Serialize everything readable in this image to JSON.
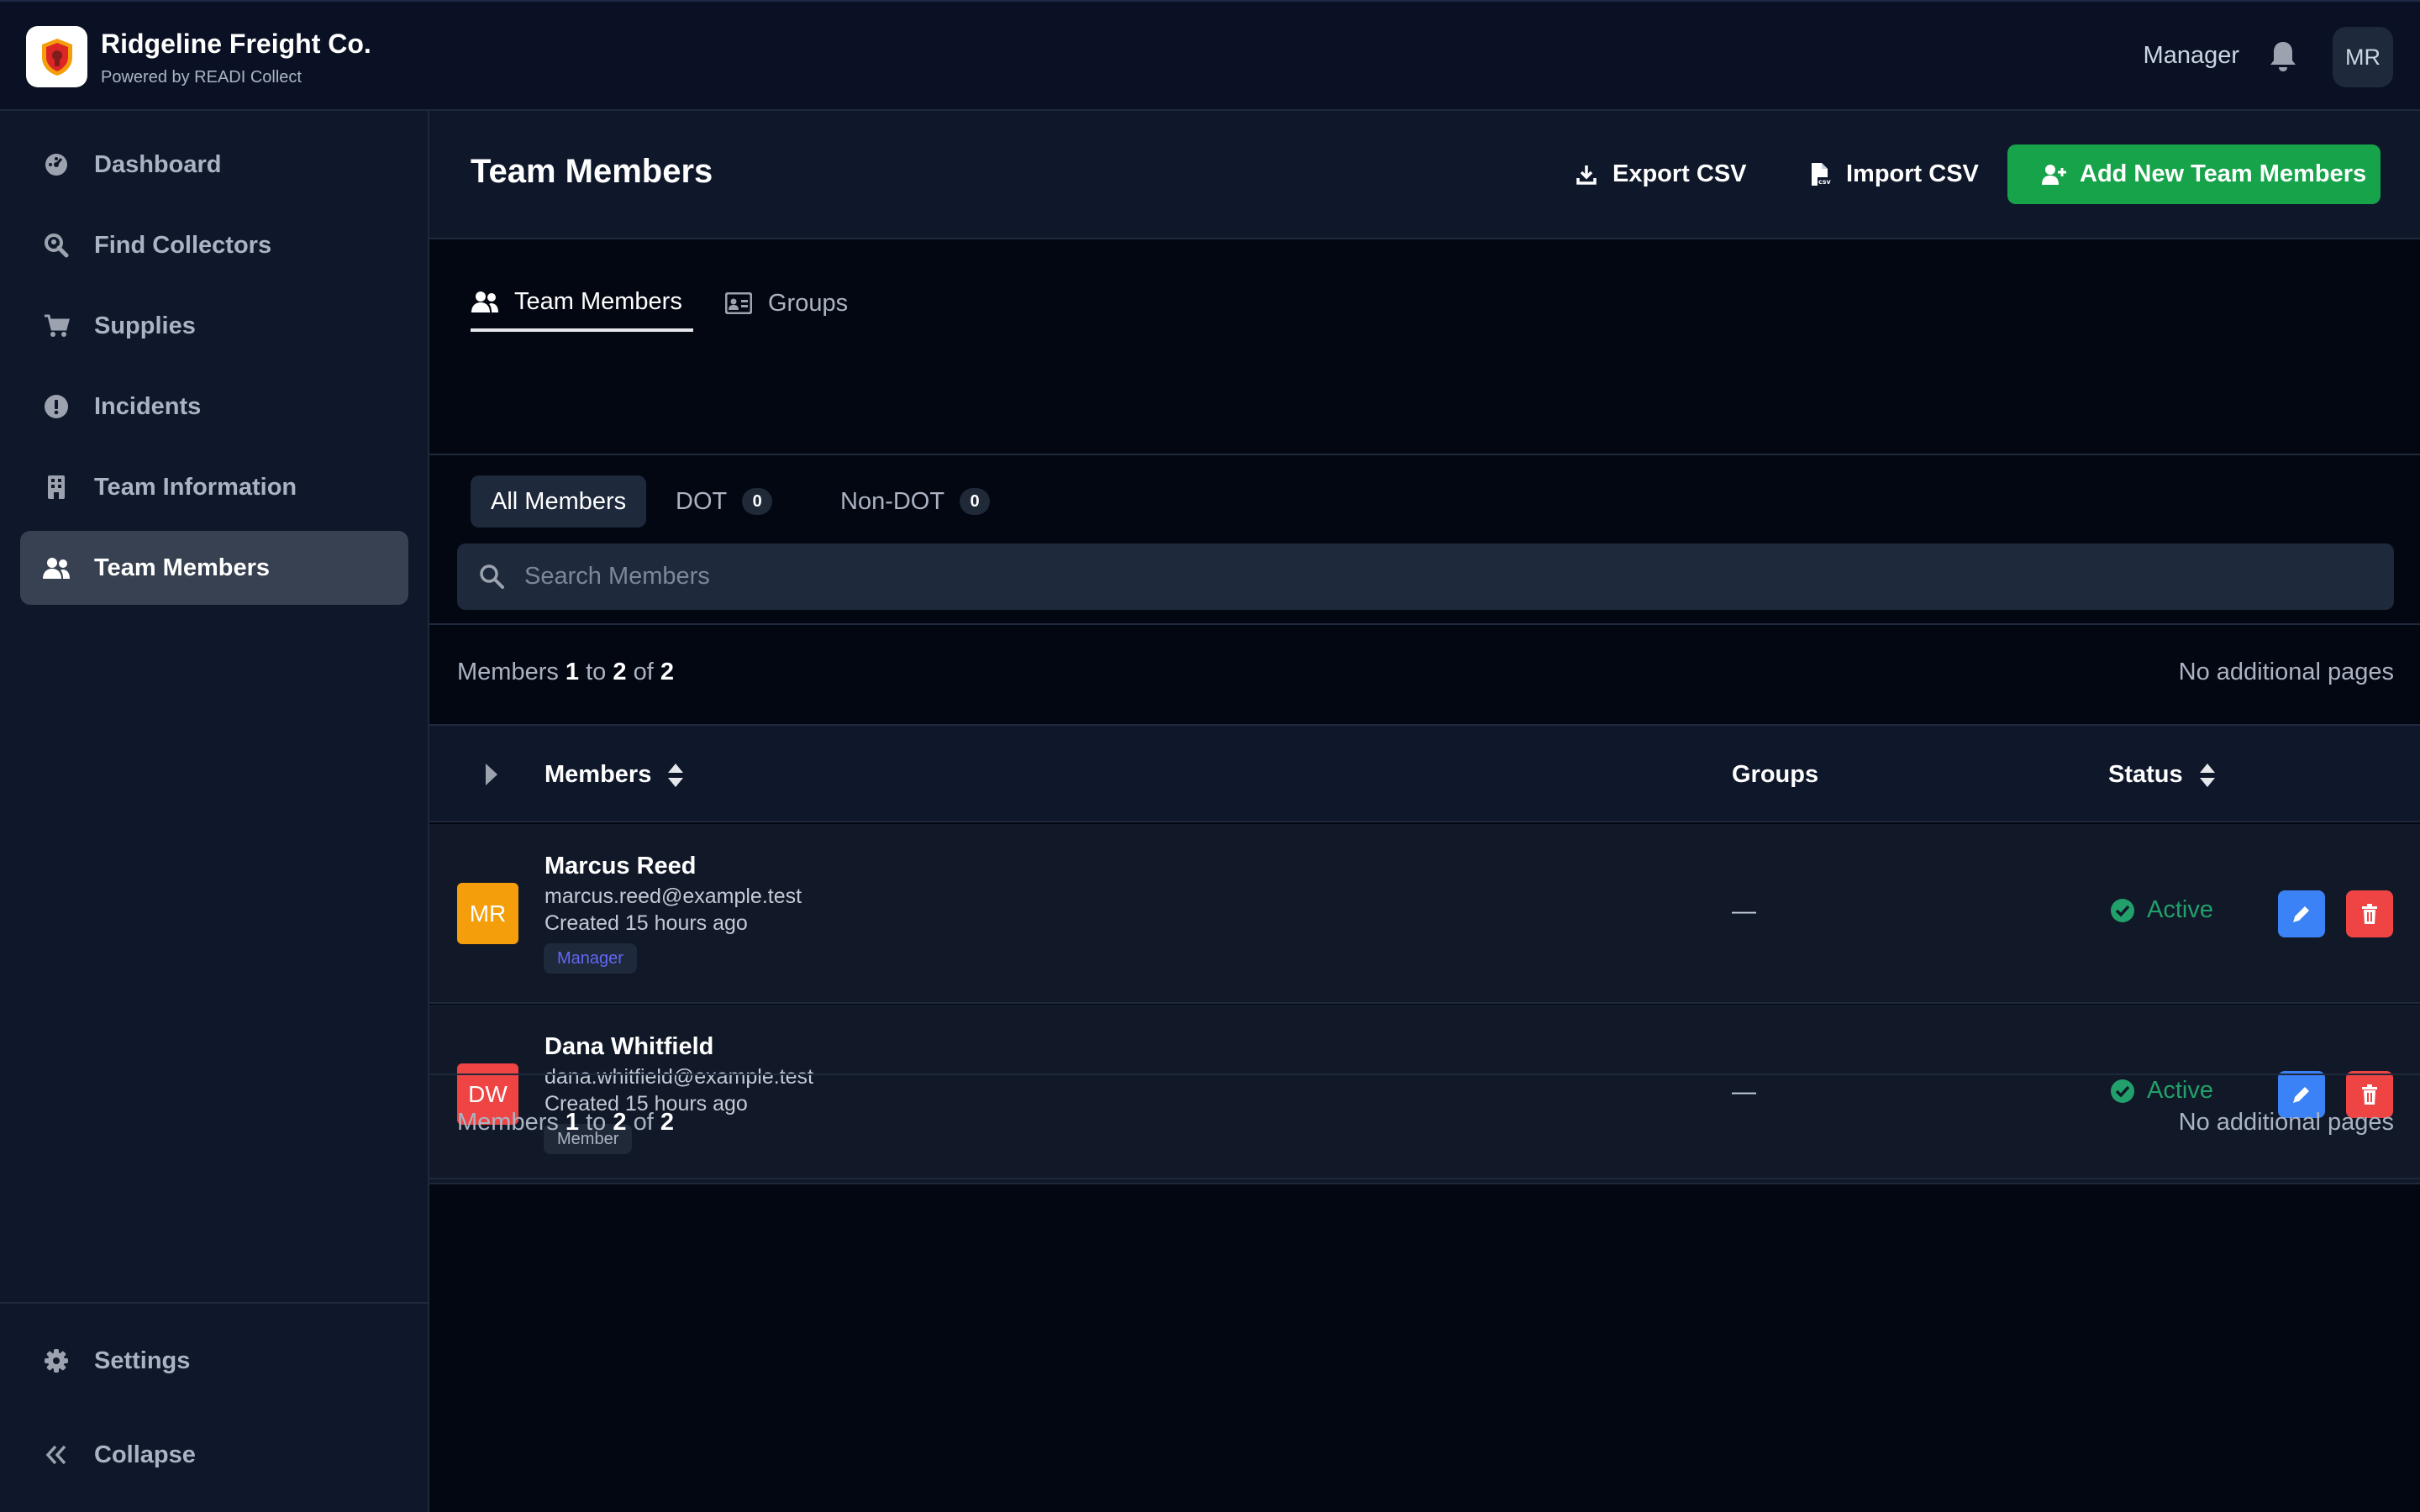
{
  "app": {
    "name": "Ridgeline Freight Co.",
    "powered_by": "Powered by READI Collect",
    "role": "Manager",
    "user_initials": "MR"
  },
  "sidebar": {
    "items": [
      {
        "label": "Dashboard",
        "icon": "dashboard-icon"
      },
      {
        "label": "Find Collectors",
        "icon": "search-location-icon"
      },
      {
        "label": "Supplies",
        "icon": "cart-icon"
      },
      {
        "label": "Incidents",
        "icon": "alert-icon"
      },
      {
        "label": "Team Information",
        "icon": "building-icon"
      },
      {
        "label": "Team Members",
        "icon": "users-icon",
        "active": true
      }
    ],
    "settings_label": "Settings",
    "collapse_label": "Collapse"
  },
  "page": {
    "title": "Team Members",
    "export_label": "Export CSV",
    "import_label": "Import CSV",
    "add_label": "Add New Team Members"
  },
  "tabs": [
    {
      "label": "Team Members",
      "active": true
    },
    {
      "label": "Groups",
      "active": false
    }
  ],
  "filters": {
    "all": "All Members",
    "dot": "DOT",
    "dot_count": "0",
    "non_dot": "Non-DOT",
    "non_dot_count": "0"
  },
  "search": {
    "placeholder": "Search Members",
    "value": ""
  },
  "pagination": {
    "prefix": "Members",
    "from": "1",
    "to_word": "to",
    "to": "2",
    "of_word": "of",
    "total": "2",
    "pages_text": "No additional pages"
  },
  "table": {
    "columns": [
      "Members",
      "Groups",
      "Status"
    ],
    "rows": [
      {
        "initials": "MR",
        "name": "Marcus Reed",
        "email": "marcus.reed@example.test",
        "created": "Created 15 hours ago",
        "role": "Manager",
        "groups": "—",
        "status": "Active",
        "avatar_color": "#f59e0b"
      },
      {
        "initials": "DW",
        "name": "Dana Whitfield",
        "email": "dana.whitfield@example.test",
        "created": "Created 15 hours ago",
        "role": "Member",
        "groups": "—",
        "status": "Active",
        "avatar_color": "#ef4444"
      }
    ]
  },
  "colors": {
    "accent_green": "#16a34a",
    "status_active": "#22a06b",
    "edit_blue": "#3b82f6",
    "delete_red": "#ef4444"
  }
}
